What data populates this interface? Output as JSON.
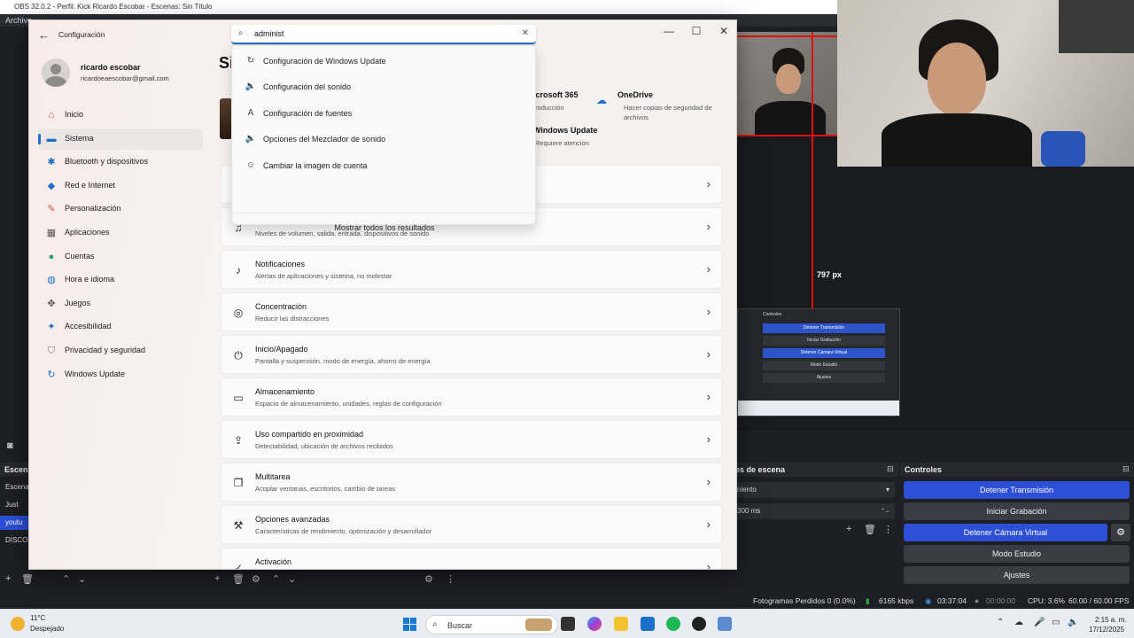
{
  "obs": {
    "title": "OBS 32.0.2 - Perfil: Kick Ricardo Escobar - Escenas: Sin Título",
    "menu_first": "Archivo",
    "preview_px_label": "797 px",
    "nested_controls_title": "Controles",
    "nested_buttons": [
      "Detener Transmisión",
      "Iniciar Grabación",
      "Detener Cámara Virtual",
      "Modo Estudio",
      "Ajustes"
    ],
    "scenes_title": "Escena",
    "scenes": [
      "Escena",
      "Just Ch",
      "youtu",
      "DISCO"
    ],
    "transitions_title": "es de escena",
    "transition_value": "niento",
    "transition_duration": "300 ms",
    "controls_title": "Controles",
    "controls": {
      "stop_stream": "Detener Transmisión",
      "start_record": "Iniciar Grabación",
      "stop_vcam": "Detener Cámara Virtual",
      "studio_mode": "Modo Estudio",
      "settings": "Ajustes"
    },
    "status": {
      "dropped": "Fotogramas Perdidos 0 (0.0%)",
      "bitrate": "6165 kbps",
      "stream_time": "03:37:04",
      "rec_time": "00:00:00",
      "cpu": "CPU: 3.6%",
      "fps": "60.00 / 60.00 FPS"
    }
  },
  "settings": {
    "window_title": "Configuración",
    "user_name": "ricardo escobar",
    "user_email": "ricardoeaescobar@gmail.com",
    "page_title_partial": "Si",
    "nav": [
      {
        "label": "Inicio",
        "icon": "home-icon",
        "color": "#c8553d"
      },
      {
        "label": "Sistema",
        "icon": "monitor-icon",
        "color": "#1f6fc6"
      },
      {
        "label": "Bluetooth y dispositivos",
        "icon": "bluetooth-icon",
        "color": "#1f6fc6"
      },
      {
        "label": "Red e Internet",
        "icon": "wifi-icon",
        "color": "#1f6fc6"
      },
      {
        "label": "Personalización",
        "icon": "brush-icon",
        "color": "#c8553d"
      },
      {
        "label": "Aplicaciones",
        "icon": "apps-icon",
        "color": "#555"
      },
      {
        "label": "Cuentas",
        "icon": "account-icon",
        "color": "#2aa06b"
      },
      {
        "label": "Hora e idioma",
        "icon": "globe-icon",
        "color": "#1f6fc6"
      },
      {
        "label": "Juegos",
        "icon": "gamepad-icon",
        "color": "#555"
      },
      {
        "label": "Accesibilidad",
        "icon": "accessibility-icon",
        "color": "#1f6fc6"
      },
      {
        "label": "Privacidad y seguridad",
        "icon": "shield-icon",
        "color": "#777"
      },
      {
        "label": "Windows Update",
        "icon": "update-icon",
        "color": "#1f6fc6"
      }
    ],
    "top_cards": {
      "m365_title": "icrosoft 365",
      "m365_sub": "troducción",
      "onedrive_title": "OneDrive",
      "onedrive_sub1": "Hacer copias de seguridad de",
      "onedrive_sub2": "archivos",
      "wu_title": "Windows Update",
      "wu_sub": "Requiere atención"
    },
    "rows": [
      {
        "title": "",
        "sub": "",
        "icon": "display-icon"
      },
      {
        "title": "",
        "sub": "Niveles de volumen, salida, entrada, dispositivos de sonido",
        "icon": "sound-icon"
      },
      {
        "title": "Notificaciones",
        "sub": "Alertas de aplicaciones y sistema, no molestar",
        "icon": "bell-icon"
      },
      {
        "title": "Concentración",
        "sub": "Reducir las distracciones",
        "icon": "focus-icon"
      },
      {
        "title": "Inicio/Apagado",
        "sub": "Pantalla y suspensión, modo de energía, ahorro de energía",
        "icon": "power-icon"
      },
      {
        "title": "Almacenamiento",
        "sub": "Espacio de almacenamiento, unidades, reglas de configuración",
        "icon": "storage-icon"
      },
      {
        "title": "Uso compartido en proximidad",
        "sub": "Detectabilidad, ubicación de archivos recibidos",
        "icon": "share-icon"
      },
      {
        "title": "Multitarea",
        "sub": "Acoplar ventanas, escritorios, cambio de tareas",
        "icon": "multitask-icon"
      },
      {
        "title": "Opciones avanzadas",
        "sub": "Características de rendimiento, optimización y desarrollador",
        "icon": "tools-icon"
      },
      {
        "title": "Activación",
        "sub": "",
        "icon": "activation-icon"
      }
    ],
    "search": {
      "value": "administ",
      "suggestions": [
        {
          "label": "Configuración de Windows Update",
          "icon": "refresh-icon"
        },
        {
          "label": "Configuración del sonido",
          "icon": "speaker-icon"
        },
        {
          "label": "Configuración de fuentes",
          "icon": "font-icon"
        },
        {
          "label": "Opciones del Mezclador de sonido",
          "icon": "speaker-icon"
        },
        {
          "label": "Cambiar la imagen de cuenta",
          "icon": "person-icon"
        }
      ],
      "show_all": "Mostrar todos los resultados"
    }
  },
  "taskbar": {
    "temp": "11°C",
    "weather": "Despejado",
    "search_label": "Buscar",
    "time": "2:15 a. m.",
    "date": "17/12/2025"
  }
}
